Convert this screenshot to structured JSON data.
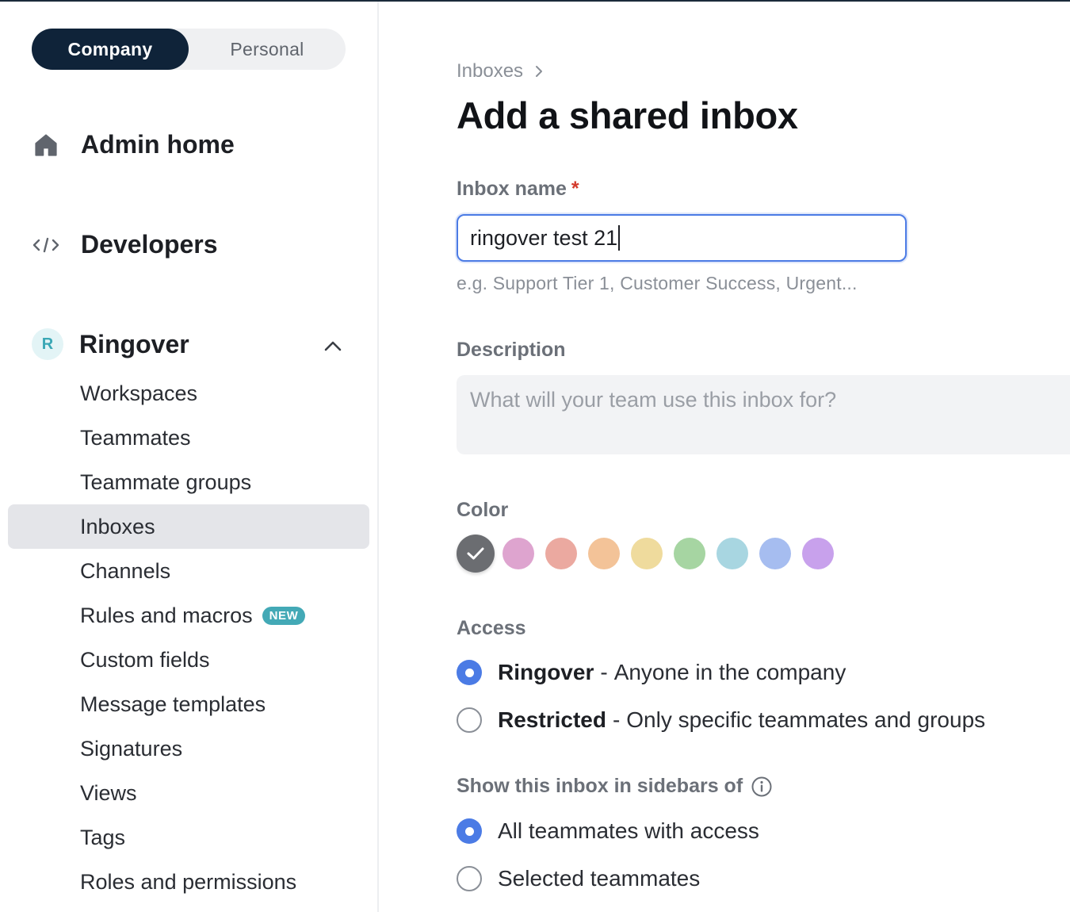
{
  "sidebar": {
    "toggle": {
      "company": "Company",
      "personal": "Personal"
    },
    "admin_home": "Admin home",
    "developers": "Developers",
    "org": {
      "initial": "R",
      "name": "Ringover"
    },
    "items": [
      {
        "label": "Workspaces"
      },
      {
        "label": "Teammates"
      },
      {
        "label": "Teammate groups"
      },
      {
        "label": "Inboxes"
      },
      {
        "label": "Channels"
      },
      {
        "label": "Rules and macros",
        "badge": "NEW"
      },
      {
        "label": "Custom fields"
      },
      {
        "label": "Message templates"
      },
      {
        "label": "Signatures"
      },
      {
        "label": "Views"
      },
      {
        "label": "Tags"
      },
      {
        "label": "Roles and permissions"
      }
    ],
    "selected_item": "Inboxes"
  },
  "main": {
    "breadcrumb": "Inboxes",
    "title": "Add a shared inbox",
    "inbox_name": {
      "label": "Inbox name",
      "required_mark": "*",
      "value": "ringover test 21",
      "hint": "e.g. Support Tier 1, Customer Success, Urgent..."
    },
    "description": {
      "label": "Description",
      "placeholder": "What will your team use this inbox for?"
    },
    "color": {
      "label": "Color",
      "swatches": [
        "#6b6d71",
        "#dea4cf",
        "#eba9a0",
        "#f3c398",
        "#efdb9d",
        "#a6d5a2",
        "#a8d6e1",
        "#a6bdf0",
        "#c8a1ec"
      ],
      "selected_index": 0
    },
    "access": {
      "label": "Access",
      "options": [
        {
          "title": "Ringover",
          "separator": "-",
          "desc": "Anyone in the company",
          "selected": true
        },
        {
          "title": "Restricted",
          "separator": "-",
          "desc": "Only specific teammates and groups",
          "selected": false
        }
      ]
    },
    "sidebars": {
      "label": "Show this inbox in sidebars of",
      "options": [
        {
          "label": "All teammates with access",
          "selected": true
        },
        {
          "label": "Selected teammates",
          "selected": false
        }
      ]
    }
  }
}
